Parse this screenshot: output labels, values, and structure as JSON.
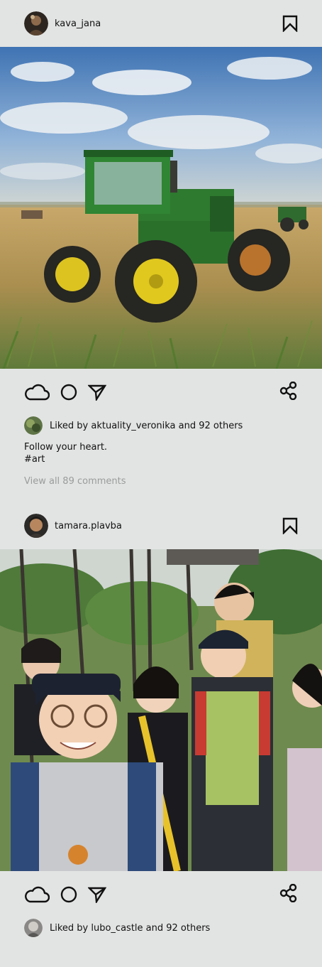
{
  "posts": [
    {
      "username": "kava_jana",
      "likes_text": "Liked by aktuality_veronika and 92 others",
      "caption_line1": "Follow your heart.",
      "caption_line2": "#art",
      "comments_link": "View all 89 comments",
      "icons": [
        "cloud-icon",
        "circle-icon",
        "send-icon",
        "share-icon",
        "bookmark-icon"
      ]
    },
    {
      "username": "tamara.plavba",
      "likes_text": "Liked by lubo_castle and 92 others",
      "icons": [
        "cloud-icon",
        "circle-icon",
        "send-icon",
        "share-icon",
        "bookmark-icon"
      ]
    }
  ],
  "colors": {
    "background": "#e2e4e3",
    "text": "#111111",
    "muted": "#9a9c9b"
  }
}
